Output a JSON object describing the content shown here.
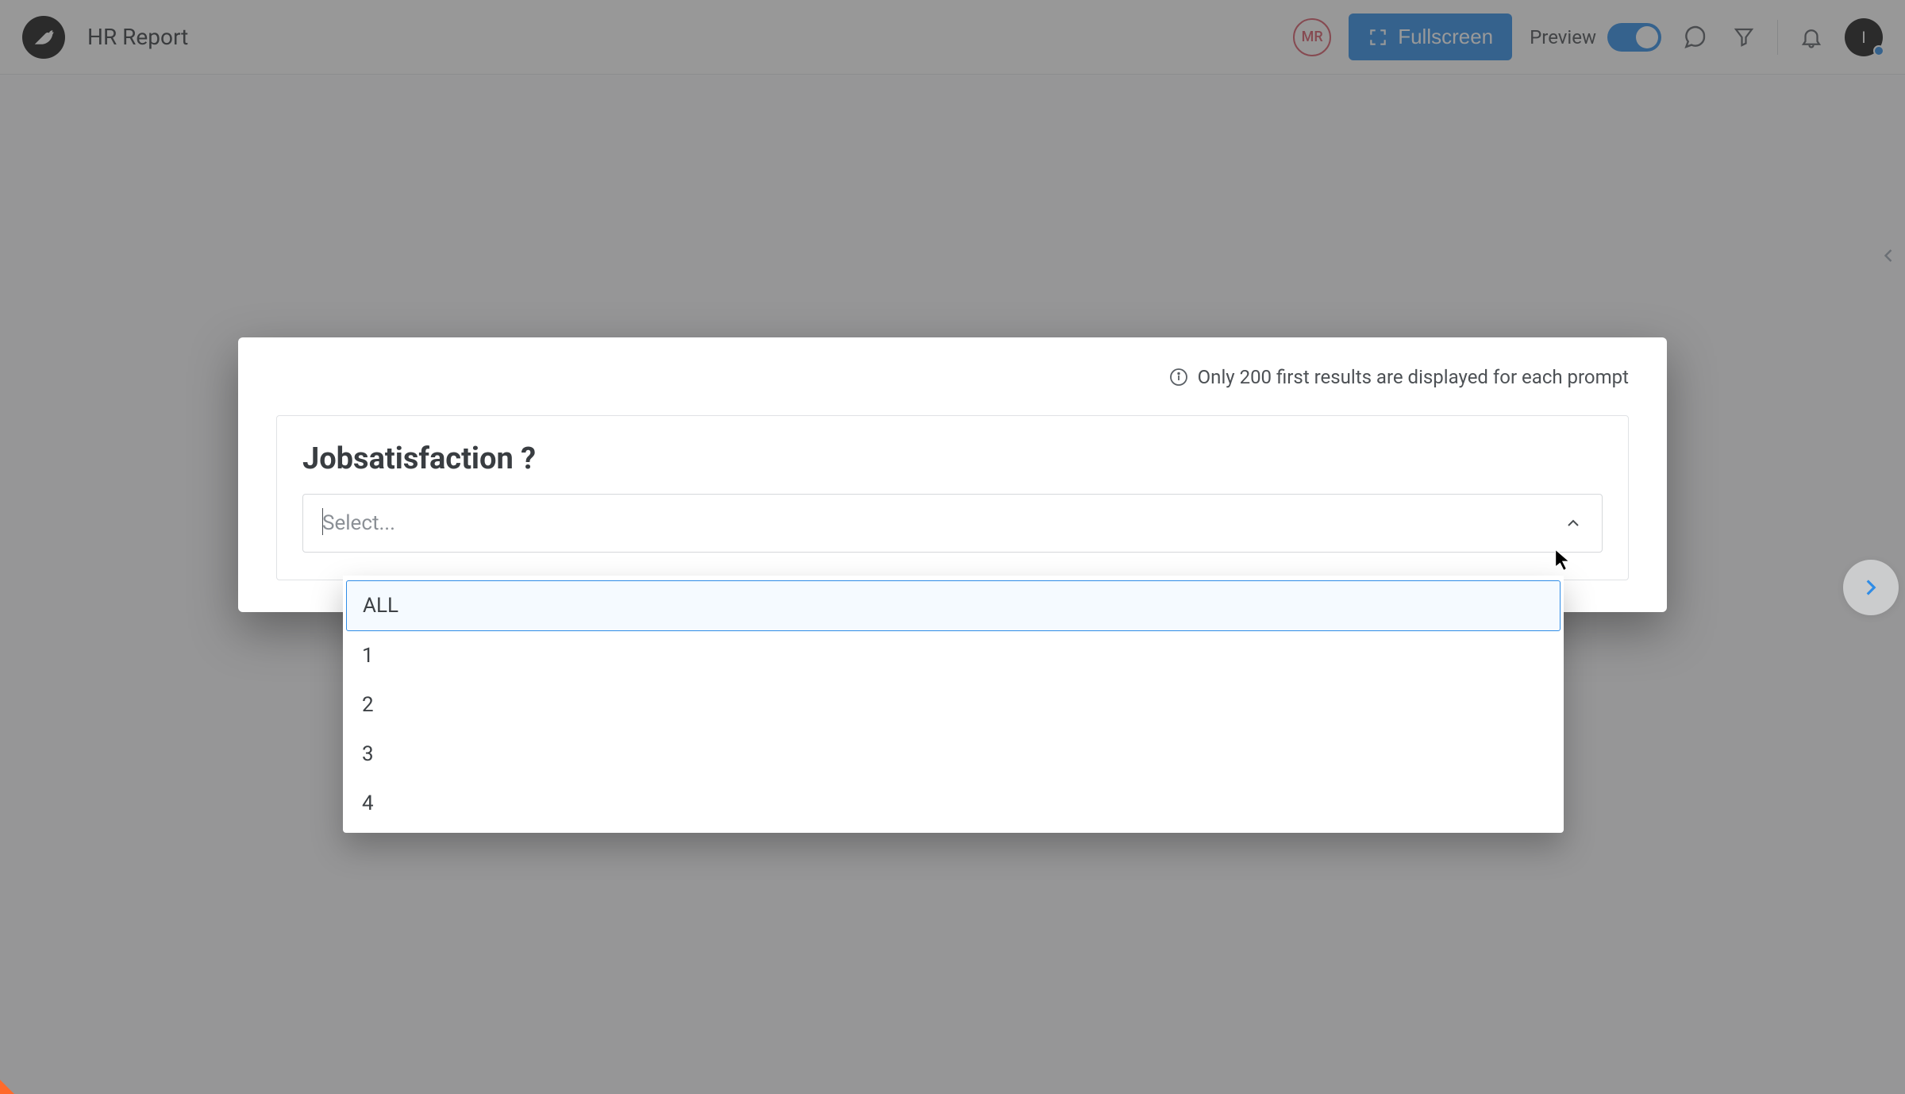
{
  "header": {
    "title": "HR Report",
    "mr_badge": "MR",
    "fullscreen_label": "Fullscreen",
    "preview_label": "Preview",
    "avatar_initial": "I"
  },
  "modal": {
    "info_text": "Only 200 first results are displayed for each prompt",
    "prompt_title": "Jobsatisfaction ?",
    "select_placeholder": "Select..."
  },
  "dropdown": {
    "options": [
      "ALL",
      "1",
      "2",
      "3",
      "4"
    ]
  }
}
